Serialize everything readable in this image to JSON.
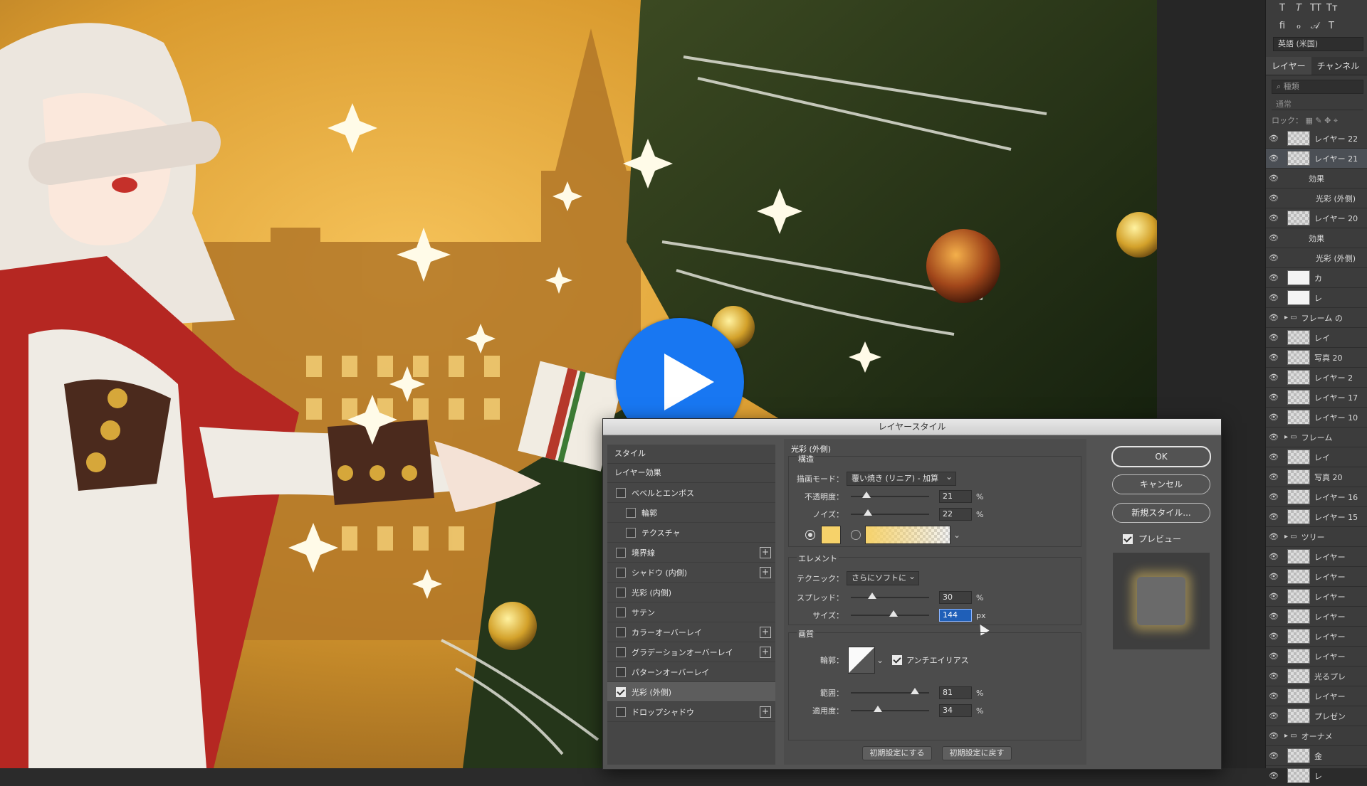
{
  "panel": {
    "lang": "英語 (米国)",
    "tabs": [
      "レイヤー",
      "チャンネル"
    ],
    "search_placeholder": "種類",
    "blend": "通常",
    "lock_label": "ロック：",
    "layers": [
      {
        "name": "レイヤー 22",
        "type": "layer"
      },
      {
        "name": "レイヤー 21",
        "type": "layer",
        "selected": true
      },
      {
        "name": "効果",
        "type": "sub"
      },
      {
        "name": "光彩 (外側)",
        "type": "sub2"
      },
      {
        "name": "レイヤー 20",
        "type": "layer"
      },
      {
        "name": "効果",
        "type": "sub"
      },
      {
        "name": "光彩 (外側)",
        "type": "sub2"
      },
      {
        "name": "カ",
        "type": "adj"
      },
      {
        "name": "レ",
        "type": "adj"
      },
      {
        "name": "フレーム の",
        "type": "folder"
      },
      {
        "name": "レイ",
        "type": "layer"
      },
      {
        "name": "写真 20",
        "type": "layer"
      },
      {
        "name": "レイヤー 2",
        "type": "layer"
      },
      {
        "name": "レイヤー 17",
        "type": "layer"
      },
      {
        "name": "レイヤー 10",
        "type": "layer"
      },
      {
        "name": "フレーム",
        "type": "folder"
      },
      {
        "name": "レイ",
        "type": "layer"
      },
      {
        "name": "写真 20",
        "type": "layer"
      },
      {
        "name": "レイヤー 16",
        "type": "layer"
      },
      {
        "name": "レイヤー 15",
        "type": "layer"
      },
      {
        "name": "ツリー",
        "type": "folder"
      },
      {
        "name": "レイヤー",
        "type": "layer"
      },
      {
        "name": "レイヤー",
        "type": "layer"
      },
      {
        "name": "レイヤー",
        "type": "layer"
      },
      {
        "name": "レイヤー",
        "type": "layer"
      },
      {
        "name": "レイヤー",
        "type": "layer"
      },
      {
        "name": "レイヤー",
        "type": "layer"
      },
      {
        "name": "光るプレ",
        "type": "layer"
      },
      {
        "name": "レイヤー",
        "type": "layer"
      },
      {
        "name": "プレゼン",
        "type": "layer"
      },
      {
        "name": "オーナメ",
        "type": "folder"
      },
      {
        "name": "金",
        "type": "layer"
      },
      {
        "name": "レ",
        "type": "layer"
      }
    ]
  },
  "dialog": {
    "title": "レイヤースタイル",
    "list_header_style": "スタイル",
    "list_header_effects": "レイヤー効果",
    "effects": [
      {
        "label": "ベベルとエンボス",
        "checked": false,
        "plus": false,
        "indent": false
      },
      {
        "label": "輪郭",
        "checked": false,
        "plus": false,
        "indent": true
      },
      {
        "label": "テクスチャ",
        "checked": false,
        "plus": false,
        "indent": true
      },
      {
        "label": "境界線",
        "checked": false,
        "plus": true,
        "indent": false
      },
      {
        "label": "シャドウ (内側)",
        "checked": false,
        "plus": true,
        "indent": false
      },
      {
        "label": "光彩 (内側)",
        "checked": false,
        "plus": false,
        "indent": false
      },
      {
        "label": "サテン",
        "checked": false,
        "plus": false,
        "indent": false
      },
      {
        "label": "カラーオーバーレイ",
        "checked": false,
        "plus": true,
        "indent": false
      },
      {
        "label": "グラデーションオーバーレイ",
        "checked": false,
        "plus": true,
        "indent": false
      },
      {
        "label": "パターンオーバーレイ",
        "checked": false,
        "plus": false,
        "indent": false
      },
      {
        "label": "光彩 (外側)",
        "checked": true,
        "plus": false,
        "indent": false,
        "selected": true
      },
      {
        "label": "ドロップシャドウ",
        "checked": false,
        "plus": true,
        "indent": false
      }
    ],
    "section_title": "光彩 (外側)",
    "structure": {
      "title": "構造",
      "blend_label": "描画モード：",
      "blend_value": "覆い焼き (リニア) - 加算",
      "opacity_label": "不透明度：",
      "opacity_value": "21",
      "noise_label": "ノイズ：",
      "noise_value": "22",
      "unit_percent": "%",
      "glow_color": "#f6d26a"
    },
    "elements": {
      "title": "エレメント",
      "technique_label": "テクニック：",
      "technique_value": "さらにソフトに",
      "spread_label": "スプレッド：",
      "spread_value": "30",
      "size_label": "サイズ：",
      "size_value": "144",
      "unit_px": "px"
    },
    "quality": {
      "title": "画質",
      "contour_label": "輪郭：",
      "antialias_label": "アンチエイリアス",
      "range_label": "範囲：",
      "range_value": "81",
      "jitter_label": "適用度：",
      "jitter_value": "34"
    },
    "make_default": "初期設定にする",
    "reset_default": "初期設定に戻す",
    "ok": "OK",
    "cancel": "キャンセル",
    "new_style": "新規スタイル...",
    "preview_label": "プレビュー"
  }
}
